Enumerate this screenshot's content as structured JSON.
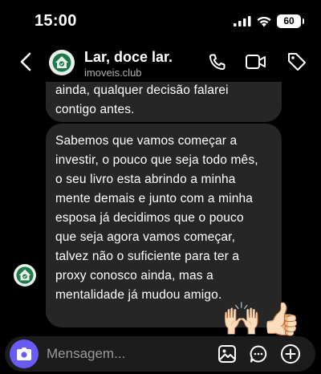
{
  "status_bar": {
    "time": "15:00",
    "battery": "60",
    "icons": [
      "signal-icon",
      "wifi-icon",
      "battery-icon"
    ]
  },
  "header": {
    "contact_name": "Lar, doce lar.",
    "contact_subtitle": "imoveis.club",
    "icons": [
      "back-chevron-icon",
      "phone-icon",
      "video-camera-icon",
      "tag-icon"
    ],
    "avatar_color": "#1e7a4e"
  },
  "messages": [
    {
      "partial": true,
      "lines": [
        "ainda, qualquer decisão falarei",
        "contigo antes."
      ]
    },
    {
      "lines": [
        "Sabemos que vamos começar a",
        "investir, o pouco que seja todo mês,",
        "o seu livro esta abrindo a minha",
        "mente demais e junto com a minha",
        "esposa já decidimos que o pouco",
        "que seja agora vamos começar,",
        "talvez não o suficiente para ter a",
        "proxy conosco ainda, mas a",
        "mentalidade já mudou amigo."
      ]
    }
  ],
  "reactions": [
    "🙌🏻",
    "👍🏻"
  ],
  "composer": {
    "placeholder": "Mensagem...",
    "icons": [
      "camera-icon",
      "gallery-icon",
      "sticker-icon",
      "plus-icon"
    ],
    "camera_color": "#6a5bf5"
  }
}
